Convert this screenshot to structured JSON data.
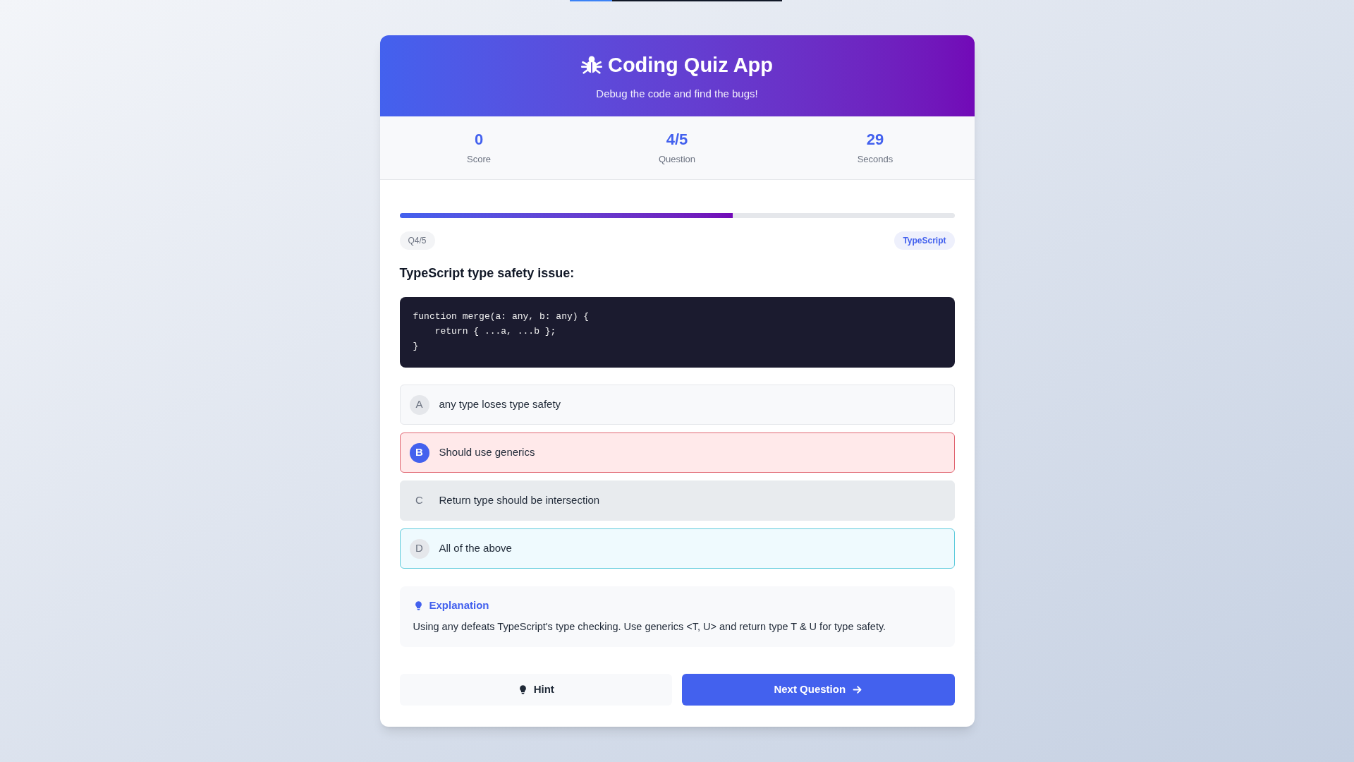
{
  "header": {
    "title": "Coding Quiz App",
    "subtitle": "Debug the code and find the bugs!"
  },
  "stats": [
    {
      "value": "0",
      "label": "Score"
    },
    {
      "value": "4/5",
      "label": "Question"
    },
    {
      "value": "29",
      "label": "Seconds"
    }
  ],
  "progress": {
    "level": 0.6
  },
  "question": {
    "number": "Q4/5",
    "tag": "TypeScript",
    "prompt": "TypeScript type safety issue:",
    "code": "function merge(a: any, b: any) {\n    return { ...a, ...b };\n}"
  },
  "options": [
    {
      "letter": "A",
      "text": "any type loses type safety",
      "selected": false,
      "kind": "plain"
    },
    {
      "letter": "B",
      "text": "Should use generics",
      "selected": true,
      "kind": "wrong"
    },
    {
      "letter": "C",
      "text": "Return type should be intersection",
      "selected": false,
      "kind": "dimmed"
    },
    {
      "letter": "D",
      "text": "All of the above",
      "selected": false,
      "kind": "correct"
    }
  ],
  "explanation": {
    "title": "Explanation",
    "text": "Using any defeats TypeScript's type checking. Use generics <T, U> and return type T & U for type safety."
  },
  "buttons": {
    "hint": "Hint",
    "next": "Next Question"
  }
}
